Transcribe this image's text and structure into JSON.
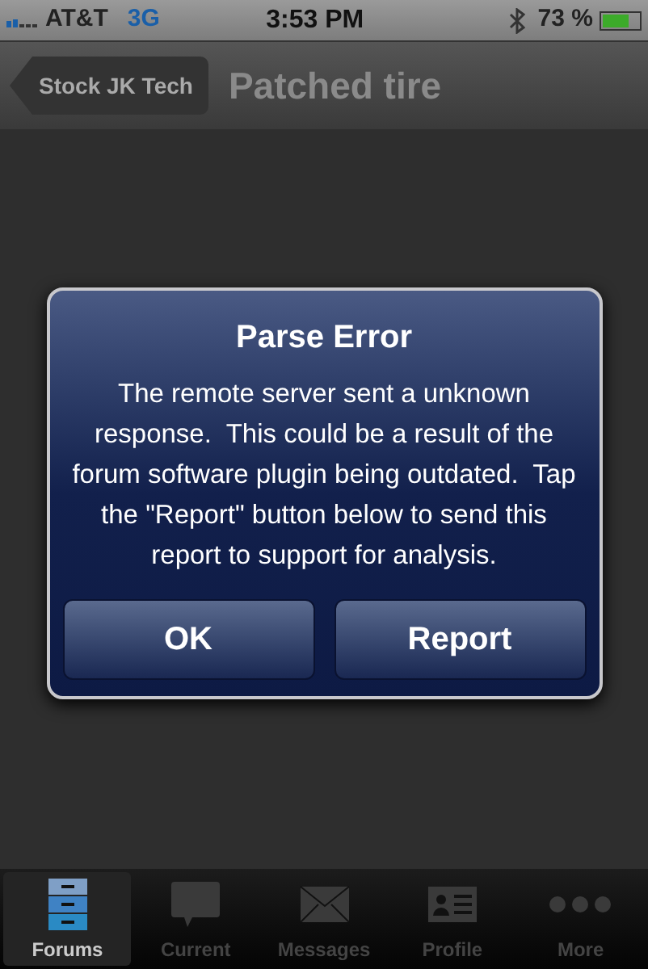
{
  "status_bar": {
    "carrier": "AT&T",
    "network": "3G",
    "time": "3:53 PM",
    "battery": "73 %"
  },
  "nav_bar": {
    "back": "Stock JK Tech",
    "title": "Patched tire"
  },
  "alert": {
    "title": "Parse Error",
    "message": "The remote server sent a unknown response.  This could be a result of the forum software plugin being outdated.  Tap the \"Report\" button below to send this report to support for analysis.",
    "buttons": [
      "OK",
      "Report"
    ]
  },
  "tab_bar": [
    {
      "label": "Forums",
      "kind": "forums",
      "selected": true
    },
    {
      "label": "Current",
      "kind": "current",
      "selected": false
    },
    {
      "label": "Messages",
      "kind": "messages",
      "selected": false
    },
    {
      "label": "Profile",
      "kind": "profile",
      "selected": false
    },
    {
      "label": "More",
      "kind": "more",
      "selected": false
    }
  ]
}
